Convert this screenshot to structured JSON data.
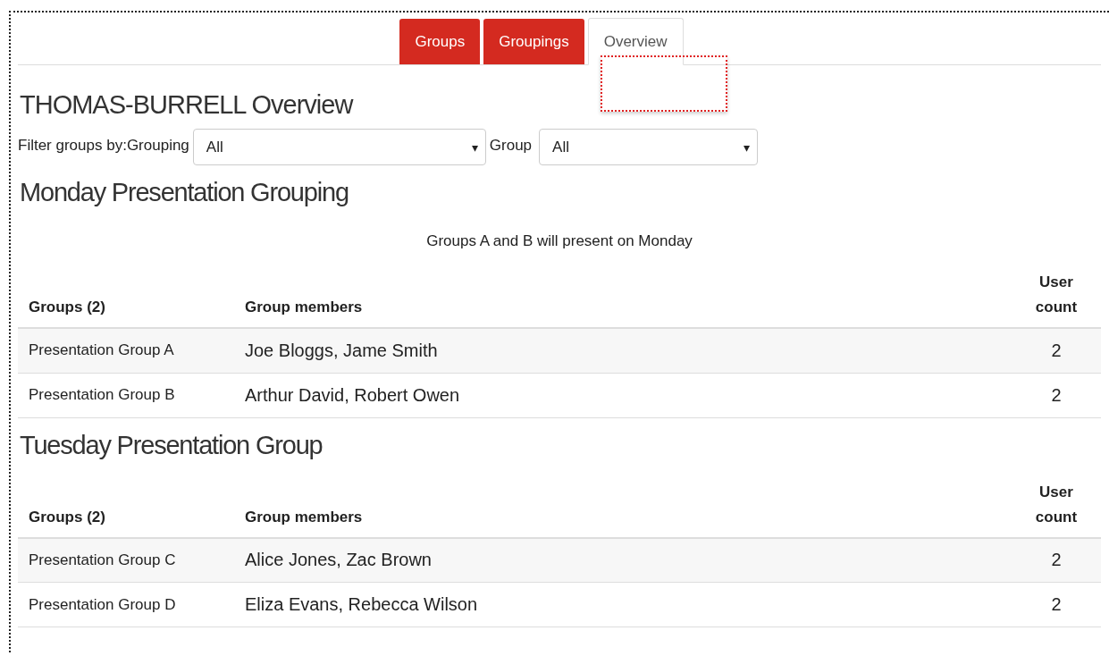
{
  "tabs": [
    {
      "label": "Groups",
      "selected": false
    },
    {
      "label": "Groupings",
      "selected": false
    },
    {
      "label": "Overview",
      "selected": true
    }
  ],
  "title": "THOMAS-BURRELL Overview",
  "filter": {
    "label": "Filter groups by:Grouping",
    "grouping": {
      "value": "All",
      "arrow": "▾"
    },
    "group_label": "Group",
    "group": {
      "value": "All",
      "arrow": "▾"
    }
  },
  "groupings": [
    {
      "title": "Monday Presentation Grouping",
      "description": "Groups A and B will present on Monday",
      "table": {
        "columns": [
          "Groups (2)",
          "Group members",
          "User count"
        ],
        "rows": [
          [
            "Presentation Group A",
            "Joe Bloggs, Jame Smith",
            "2"
          ],
          [
            "Presentation Group B",
            "Arthur David, Robert Owen",
            "2"
          ]
        ]
      }
    },
    {
      "title": "Tuesday Presentation Group",
      "table": {
        "columns": [
          "Groups (2)",
          "Group members",
          "User count"
        ],
        "rows": [
          [
            "Presentation Group C",
            "Alice Jones, Zac Brown",
            "2"
          ],
          [
            "Presentation Group D",
            "Eliza Evans, Rebecca Wilson",
            "2"
          ]
        ]
      }
    }
  ]
}
